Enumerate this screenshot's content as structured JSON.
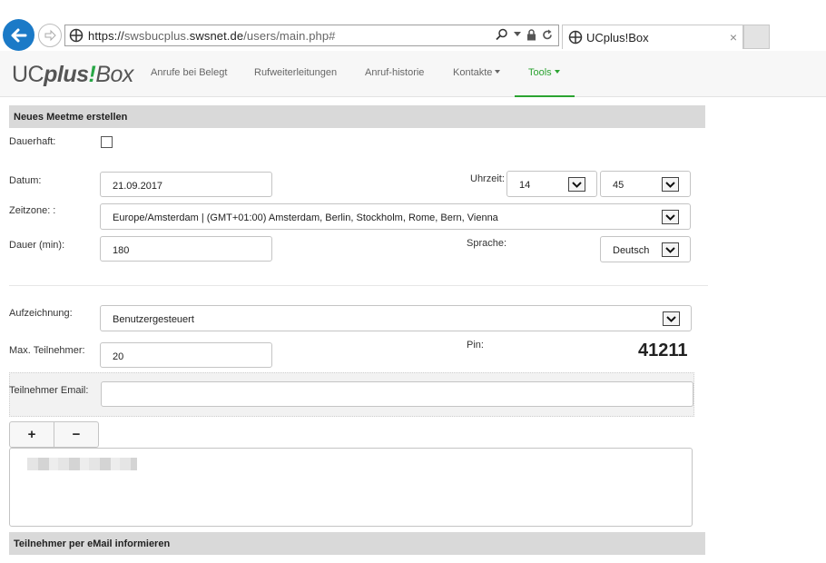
{
  "browser": {
    "url_scheme": "https://",
    "url_host_sub": "swsbucplus.",
    "url_host_main": "swsnet.de",
    "url_path": "/users/main.php#",
    "tab_title": "UCplus!Box",
    "tab_close": "×"
  },
  "app": {
    "logo_uc": "UC",
    "logo_plus": "plus",
    "logo_ex": "!",
    "logo_box": "Box",
    "nav": [
      {
        "label": "Anrufe bei Belegt"
      },
      {
        "label": "Rufweiterleitungen"
      },
      {
        "label": "Anruf-historie"
      },
      {
        "label": "Kontakte"
      },
      {
        "label": "Tools"
      }
    ],
    "accent_color": "#2ba331"
  },
  "form": {
    "section_title": "Neues Meetme erstellen",
    "dauerhaft_label": "Dauerhaft:",
    "datum_label": "Datum:",
    "datum_value": "21.09.2017",
    "uhrzeit_label": "Uhrzeit:",
    "hour_value": "14",
    "minute_value": "45",
    "zeitzone_label": "Zeitzone: :",
    "zeitzone_value": "Europe/Amsterdam | (GMT+01:00) Amsterdam, Berlin, Stockholm, Rome, Bern, Vienna",
    "dauer_label": "Dauer (min):",
    "dauer_value": "180",
    "sprache_label": "Sprache:",
    "sprache_value": "Deutsch",
    "aufzeichnung_label": "Aufzeichnung:",
    "aufzeichnung_value": "Benutzergesteuert",
    "max_label": "Max. Teilnehmer:",
    "max_value": "20",
    "pin_label": "Pin:",
    "pin_value": "41211",
    "email_label": "Teilnehmer Email:",
    "email_value": "",
    "add_label": "+",
    "remove_label": "−",
    "notify_section_title": "Teilnehmer per eMail informieren"
  }
}
